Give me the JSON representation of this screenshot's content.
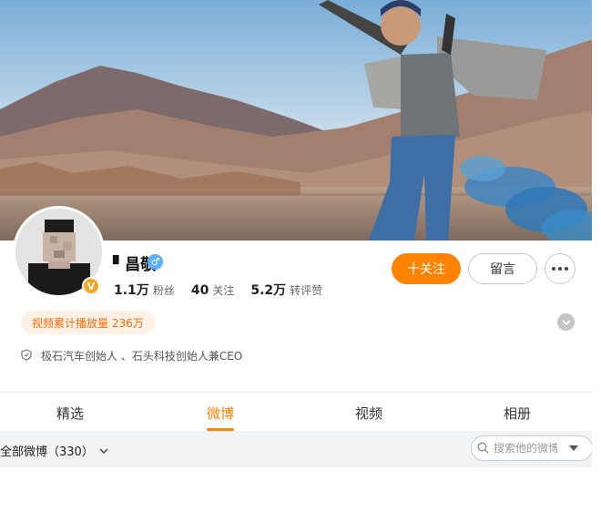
{
  "profile": {
    "name": "▘昌敬",
    "gender_icon": "male-icon",
    "verified_icon": "verified-v-icon",
    "stats": [
      {
        "value": "1.1万",
        "label": "粉丝"
      },
      {
        "value": "40",
        "label": "关注"
      },
      {
        "value": "5.2万",
        "label": "转评赞"
      }
    ],
    "play_count": "视频累计播放量 236万",
    "bio": "极石汽车创始人 、石头科技创始人兼CEO"
  },
  "actions": {
    "follow_label": "十关注",
    "message_label": "留言"
  },
  "tabs": [
    {
      "label": "精选",
      "active": false
    },
    {
      "label": "微博",
      "active": true
    },
    {
      "label": "视频",
      "active": false
    },
    {
      "label": "相册",
      "active": false
    }
  ],
  "filter": {
    "label": "全部微博（330）",
    "search_placeholder": "搜索他的微博"
  },
  "colors": {
    "accent": "#ff8200",
    "verified": "#f5a623",
    "gender_male": "#5ab2ff"
  }
}
